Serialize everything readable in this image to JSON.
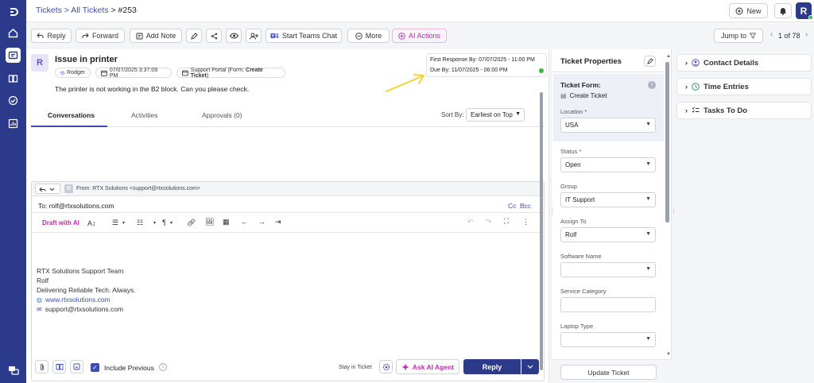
{
  "breadcrumb": {
    "tickets": "Tickets",
    "sep1": ">",
    "all_tickets": "All Tickets",
    "sep2": ">",
    "current": "#253"
  },
  "top_actions": {
    "new_label": "New",
    "user_initial": "R"
  },
  "toolbar": {
    "reply": "Reply",
    "forward": "Forward",
    "add_note": "Add Note",
    "start_teams_chat": "Start Teams Chat",
    "more": "More",
    "ai_actions": "AI Actions",
    "jump_to": "Jump to",
    "pagination": "1 of 78"
  },
  "ticket": {
    "avatar_initial": "R",
    "title": "Issue in printer",
    "requester": "Rodger",
    "created": "07/07/2025 3:37:09 PM",
    "source_prefix": "Support Portal (Form: ",
    "source_form": "Create Ticket",
    "source_suffix": ")",
    "description": "The printer is not working in the B2 block. Can you please check.",
    "sla": {
      "first_response_label": "First Response By:",
      "first_response_value": "07/07/2025 - 11:00 PM",
      "due_label": "Due By:",
      "due_value": "11/07/2025 - 06:00 PM"
    }
  },
  "tabs": {
    "conversations": "Conversations",
    "activities": "Activities",
    "approvals": "Approvals (0)"
  },
  "sort": {
    "label": "Sort By:",
    "value": "Earliest on Top"
  },
  "editor": {
    "from_label": "From:",
    "from_value": "RTX Solutions <support@rtxsolutions.com>",
    "to_value": "To: rolf@rtxsolutions.com",
    "cc": "Cc",
    "bcc": "Bcc",
    "draft_ai": "Draft with AI",
    "signature": {
      "line1": "RTX Solutions Support Team",
      "line2": "Rolf",
      "line3": "Delivering Reliable Tech. Always.",
      "website": "www.rtxsolutions.com",
      "email": "support@rtxsolutions.com"
    },
    "include_previous": "Include Previous",
    "stay_in_ticket": "Stay in Ticket",
    "ask_ai_agent": "Ask AI Agent",
    "reply_button": "Reply"
  },
  "properties": {
    "title": "Ticket Properties",
    "form_label": "Ticket Form:",
    "form_value": "Create Ticket",
    "location_label": "Location",
    "location_value": "USA",
    "status_label": "Status",
    "status_value": "Open",
    "group_label": "Group",
    "group_value": "IT Support",
    "assign_label": "Assign To",
    "assign_value": "Rolf",
    "software_label": "Software Name",
    "software_value": "",
    "category_label": "Service Category",
    "category_value": "",
    "laptop_label": "Laptop Type",
    "laptop_value": "",
    "required_mark": "*",
    "update_button": "Update Ticket"
  },
  "right_panel": {
    "contact_details": "Contact Details",
    "time_entries": "Time Entries",
    "tasks_to_do": "Tasks To Do"
  },
  "colors": {
    "rail": "#2c3a8c",
    "accent": "#3d4eb0",
    "ai_magenta": "#c02bb0",
    "arrow_yellow": "#f4d33a",
    "online_green": "#3bb54a"
  }
}
